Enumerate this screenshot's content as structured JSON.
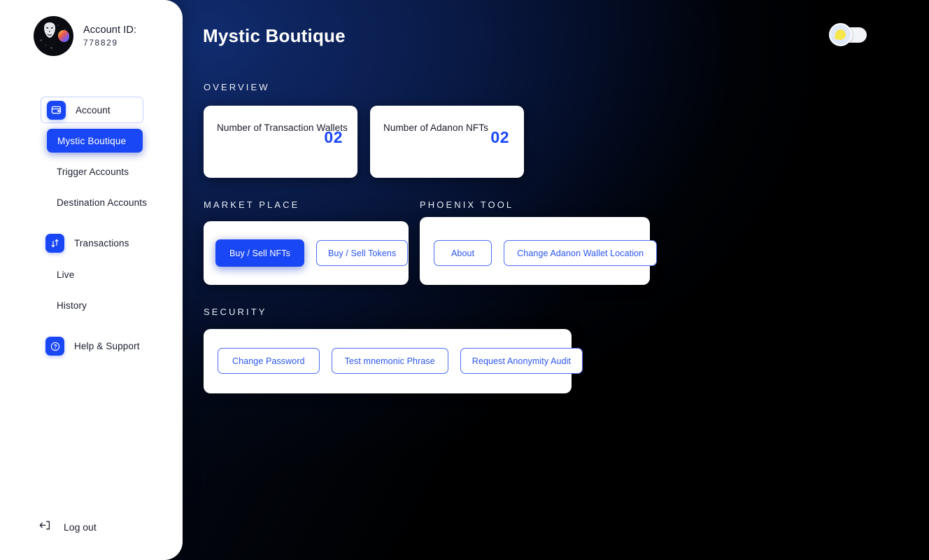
{
  "account": {
    "label": "Account ID:",
    "id": "778829",
    "avatar_icon": "anonymous-mask-avatar"
  },
  "sidebar": {
    "nav": {
      "account_item": {
        "label": "Account",
        "icon": "wallet-icon"
      },
      "active_item": {
        "label": "Mystic Boutique"
      },
      "plain_items": [
        {
          "label": "Trigger Accounts"
        },
        {
          "label": "Destination Accounts"
        }
      ],
      "transactions": {
        "label": "Transactions",
        "icon": "transfer-arrows-icon"
      },
      "transaction_children": [
        {
          "label": "Live"
        },
        {
          "label": "History"
        }
      ],
      "help": {
        "label": "Help & Support",
        "icon": "question-circle-icon"
      }
    },
    "logout": {
      "label": "Log out",
      "icon": "logout-arrow-icon"
    }
  },
  "header": {
    "title": "Mystic Boutique",
    "theme_toggle": {
      "icon": "sun-icon",
      "state": "light"
    }
  },
  "sections": {
    "overview": {
      "label": "OVERVIEW",
      "stats": [
        {
          "title": "Number of Transaction Wallets",
          "value": "02"
        },
        {
          "title": "Number of Adanon NFTs",
          "value": "02"
        }
      ]
    },
    "market_place": {
      "label": "MARKET PLACE",
      "buttons": [
        {
          "label": "Buy / Sell NFTs",
          "style": "filled"
        },
        {
          "label": "Buy / Sell Tokens",
          "style": "outline"
        }
      ]
    },
    "phoenix_tool": {
      "label": "PHOENIX TOOL",
      "buttons": [
        {
          "label": "About",
          "style": "outline"
        },
        {
          "label": "Change Adanon Wallet Location",
          "style": "outline"
        }
      ]
    },
    "security": {
      "label": "SECURITY",
      "buttons": [
        {
          "label": "Change Password",
          "style": "outline"
        },
        {
          "label": "Test mnemonic Phrase",
          "style": "outline"
        },
        {
          "label": "Request Anonymity Audit",
          "style": "outline"
        }
      ]
    }
  },
  "colors": {
    "accent": "#1a47f5",
    "accent_text": "#2a55ee",
    "background_dark": "#000000",
    "background_navy": "#123078",
    "card": "#ffffff"
  }
}
